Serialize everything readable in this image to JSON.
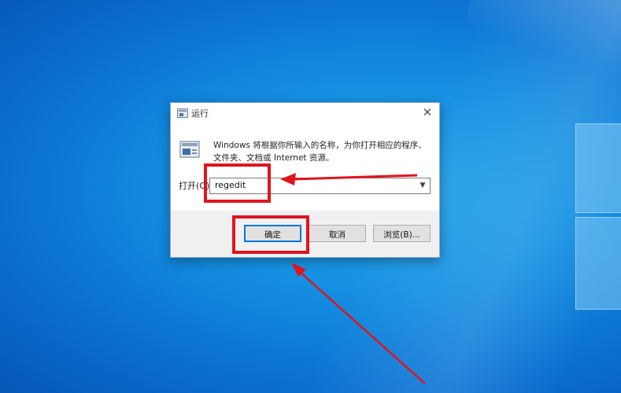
{
  "window": {
    "title": "运行",
    "description": "Windows 将根据你所输入的名称，为你打开相应的程序、文件夹、文档或 Internet 资源。",
    "open_label": "打开(O):",
    "input_value": "regedit"
  },
  "buttons": {
    "ok": "确定",
    "cancel": "取消",
    "browse": "浏览(B)..."
  },
  "colors": {
    "annotation": "#e0141e",
    "desktop": "#1590e2"
  },
  "icons": {
    "title": "run-icon",
    "app": "run-app-icon",
    "close": "close-icon",
    "dropdown": "chevron-down-icon"
  }
}
